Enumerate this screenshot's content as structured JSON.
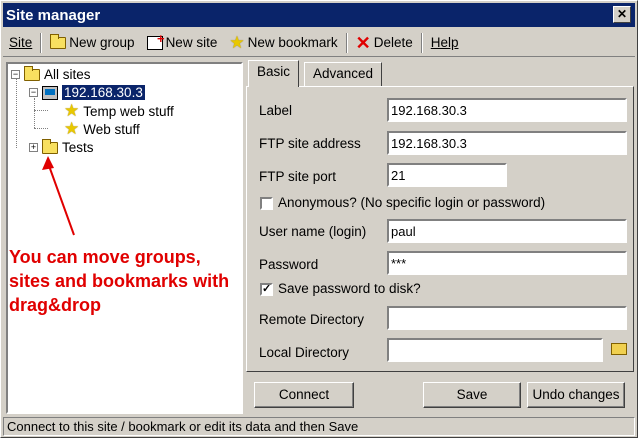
{
  "window": {
    "title": "Site manager"
  },
  "menu": {
    "site": "Site",
    "new_group": "New group",
    "new_site": "New site",
    "new_bookmark": "New bookmark",
    "delete": "Delete",
    "help": "Help"
  },
  "tree": {
    "root": "All sites",
    "site": "192.168.30.3",
    "bookmarks": [
      "Temp web stuff",
      "Web stuff"
    ],
    "group": "Tests"
  },
  "annotation": "You can move groups, sites and bookmarks with drag&drop",
  "tabs": {
    "basic": "Basic",
    "advanced": "Advanced"
  },
  "form": {
    "label_label": "Label",
    "label_value": "192.168.30.3",
    "address_label": "FTP site address",
    "address_value": "192.168.30.3",
    "port_label": "FTP site port",
    "port_value": "21",
    "anonymous_label": "Anonymous? (No specific login or password)",
    "anonymous_checked": false,
    "user_label": "User name (login)",
    "user_value": "paul",
    "password_label": "Password",
    "password_value": "***",
    "save_pw_label": "Save password to disk?",
    "save_pw_checked": true,
    "remote_label": "Remote Directory",
    "remote_value": "",
    "local_label": "Local Directory",
    "local_value": ""
  },
  "buttons": {
    "connect": "Connect",
    "save": "Save",
    "undo": "Undo changes"
  },
  "status": "Connect to this site / bookmark or edit its data and then Save",
  "colors": {
    "title_bar": "#0a246a",
    "annotation": "#e00000",
    "selection": "#0a246a"
  }
}
